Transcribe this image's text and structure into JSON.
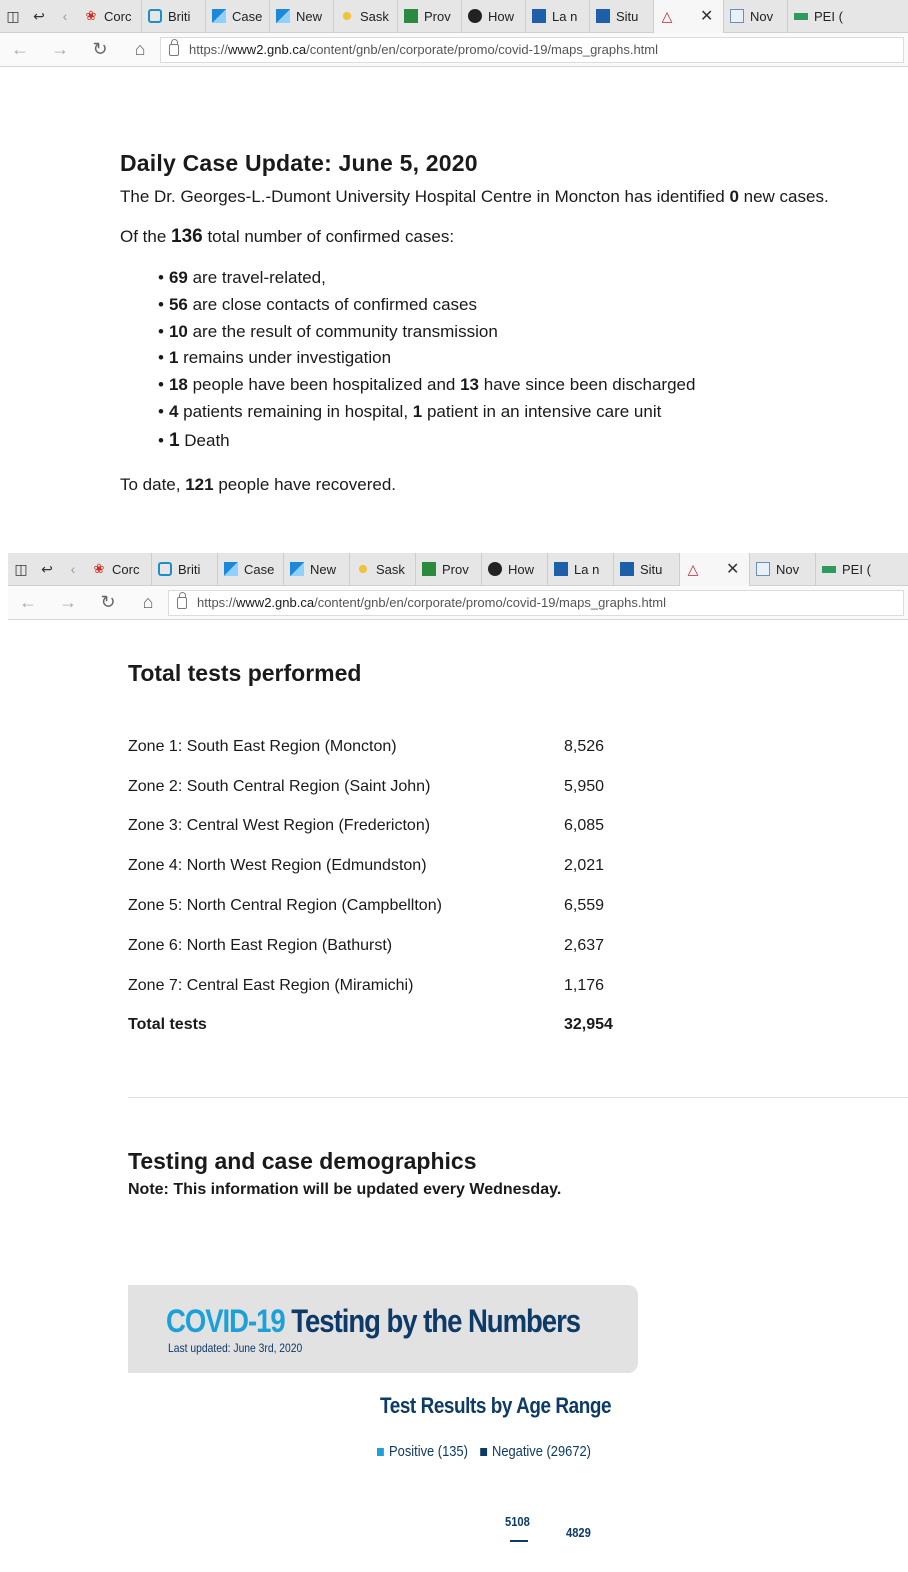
{
  "browser": {
    "tabs": [
      {
        "label": "Corc",
        "icon": "maple-leaf-icon"
      },
      {
        "label": "Briti",
        "icon": "b-logo-icon"
      },
      {
        "label": "Case",
        "icon": "chart-favicon"
      },
      {
        "label": "New",
        "icon": "chart-favicon"
      },
      {
        "label": "Sask",
        "icon": "sask-favicon"
      },
      {
        "label": "Prov",
        "icon": "prov-favicon"
      },
      {
        "label": "How",
        "icon": "shield-favicon"
      },
      {
        "label": "La n",
        "icon": "quebec-favicon"
      },
      {
        "label": "Situ",
        "icon": "quebec-favicon"
      },
      {
        "label": "",
        "icon": "pdf-favicon",
        "active": true
      },
      {
        "label": "Nov",
        "icon": "nova-scotia-favicon"
      },
      {
        "label": "PEI (",
        "icon": "pei-favicon"
      }
    ],
    "url_prefix": "https://",
    "url_host": "www2.gnb.ca",
    "url_path": "/content/gnb/en/corporate/promo/covid-19/maps_graphs.html"
  },
  "update": {
    "title": "Daily Case Update: June 5, 2020",
    "hospital_pre": "The Dr. Georges-L.-Dumont University Hospital Centre in Moncton has identified ",
    "hospital_num": "0",
    "hospital_post": " new cases.",
    "total_pre": "Of the ",
    "total_num": "136",
    "total_post": " total number of confirmed cases:",
    "items": [
      {
        "num": "69",
        "text": " are travel-related,"
      },
      {
        "num": "56",
        "text": " are close contacts of confirmed cases"
      },
      {
        "num": "10",
        "text": " are the result of community transmission"
      },
      {
        "num": "1",
        "text": " remains under investigation"
      },
      {
        "num": "18",
        "text": " people have been hospitalized and ",
        "num2": "13",
        "text2": " have since been discharged"
      },
      {
        "num": "4",
        "text": " patients remaining in hospital, ",
        "num2": "1",
        "text2": " patient in an intensive care unit"
      },
      {
        "num": "1",
        "text": " Death"
      }
    ],
    "recovered_pre": "To date, ",
    "recovered_num": "121",
    "recovered_post": " people have recovered."
  },
  "tests": {
    "title": "Total tests performed",
    "rows": [
      {
        "zone": "Zone 1: South East Region (Moncton)",
        "count": "8,526"
      },
      {
        "zone": "Zone 2: South Central Region (Saint John)",
        "count": "5,950"
      },
      {
        "zone": "Zone 3: Central West Region (Fredericton)",
        "count": "6,085"
      },
      {
        "zone": "Zone 4: North West Region (Edmundston)",
        "count": "2,021"
      },
      {
        "zone": "Zone 5: North Central Region (Campbellton)",
        "count": "6,559"
      },
      {
        "zone": "Zone 6: North East Region (Bathurst)",
        "count": "2,637"
      },
      {
        "zone": "Zone 7: Central East Region (Miramichi)",
        "count": "1,176"
      }
    ],
    "total_label": "Total tests",
    "total_count": "32,954"
  },
  "demographics": {
    "title": "Testing and case demographics",
    "note": "Note: This information will be updated every Wednesday."
  },
  "infographic": {
    "title_part1": "COVID-19",
    "title_part2": " Testing by the Numbers",
    "subtitle": "Last updated: June 3rd, 2020",
    "chart_title": "Test Results by Age Range",
    "legend_positive": "Positive (135)",
    "legend_negative": "Negative (29672)",
    "colors": {
      "positive": "#1ca0d9",
      "negative": "#0e3a68"
    }
  },
  "chart_data": {
    "type": "bar",
    "title": "Test Results by Age Range",
    "series": [
      {
        "name": "Positive (135)",
        "values": []
      },
      {
        "name": "Negative (29672)",
        "values": [
          5108,
          4829
        ]
      }
    ],
    "visible_value_labels": [
      5108,
      4829
    ]
  }
}
